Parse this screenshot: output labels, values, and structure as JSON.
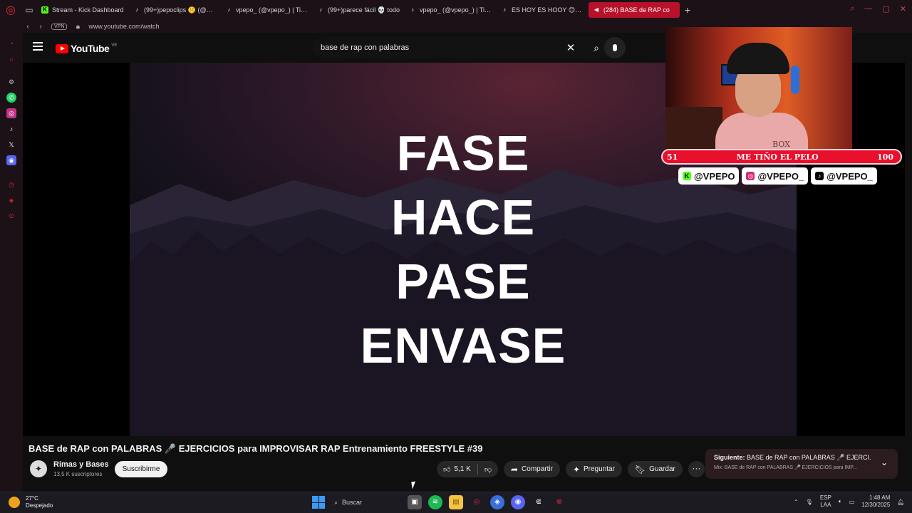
{
  "browser": {
    "tabs": [
      {
        "label": "Stream - Kick Dashboard",
        "icon": "kick-icon",
        "color": "#53fc18"
      },
      {
        "label": "(99+)pepoclips 🤫 (@vpe",
        "icon": "tiktok-icon",
        "color": "#ffffff"
      },
      {
        "label": "vpepo_ (@vpepo_) | TikTo",
        "icon": "tiktok-icon",
        "color": "#ffffff"
      },
      {
        "label": "(99+)parece fácil 💀 todo",
        "icon": "tiktok-icon",
        "color": "#ffffff"
      },
      {
        "label": "vpepo_ (@vpepo_) | TikTo",
        "icon": "tiktok-icon",
        "color": "#ffffff"
      },
      {
        "label": "ES HOY ES HOOY 😊😊 #",
        "icon": "tiktok-icon",
        "color": "#ffffff"
      },
      {
        "label": "(284) BASE de RAP co",
        "icon": "youtube-icon",
        "color": "#ff0000",
        "active": true
      }
    ],
    "url": "www.youtube.com/watch",
    "vpn": "VPN"
  },
  "youtube": {
    "logo_text": "YouTube",
    "country": "VE",
    "search_query": "base de rap con palabras"
  },
  "video": {
    "words": [
      "FASE",
      "HACE",
      "PASE",
      "ENVASE"
    ],
    "title": "BASE de RAP con PALABRAS 🎤 EJERCICIOS para IMPROVISAR RAP Entrenamiento FREESTYLE #39"
  },
  "overlay": {
    "goal_current": "51",
    "goal_label": "ME TIÑO EL PELO",
    "goal_target": "100",
    "goal_progress": 0.51,
    "socials": [
      "@VPEPO",
      "@VPEPO_",
      "@VPEPO_"
    ],
    "cam_brand": "BOX"
  },
  "channel": {
    "name": "Rimas y Bases",
    "subscribers": "13,5 K suscriptores",
    "subscribe_label": "Suscribirme"
  },
  "actions": {
    "likes": "5,1 K",
    "share": "Compartir",
    "ask": "Preguntar",
    "save": "Guardar"
  },
  "up_next": {
    "prefix": "Siguiente:",
    "title": "BASE de RAP con PALABRAS 🎤 EJERCI...",
    "mix": "Mix: BASE de RAP con PALABRAS 🎤 EJERCICIOS para IMP..."
  },
  "taskbar": {
    "temperature": "27°C",
    "weather": "Despejado",
    "search_placeholder": "Buscar",
    "lang_line1": "ESP",
    "lang_line2": "LAA",
    "time": "1:48 AM",
    "date": "12/30/2025"
  },
  "colors": {
    "accent": "#b8112a",
    "youtube_red": "#ff0000",
    "goal_bar": "#e8102d"
  }
}
